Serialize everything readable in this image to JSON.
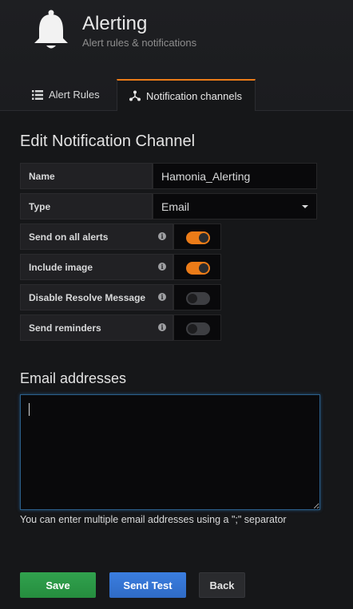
{
  "header": {
    "title": "Alerting",
    "subtitle": "Alert rules & notifications",
    "icon": "bell-icon"
  },
  "tabs": [
    {
      "label": "Alert Rules",
      "icon": "list-icon",
      "active": false
    },
    {
      "label": "Notification channels",
      "icon": "channels-icon",
      "active": true
    }
  ],
  "form": {
    "title": "Edit Notification Channel",
    "name": {
      "label": "Name",
      "value": "Hamonia_Alerting"
    },
    "type": {
      "label": "Type",
      "value": "Email"
    },
    "toggles": [
      {
        "label": "Send on all alerts",
        "checked": true
      },
      {
        "label": "Include image",
        "checked": true
      },
      {
        "label": "Disable Resolve Message",
        "checked": false
      },
      {
        "label": "Send reminders",
        "checked": false
      }
    ],
    "info_glyph": "i"
  },
  "email": {
    "title": "Email addresses",
    "value": "",
    "help": "You can enter multiple email addresses using a \";\" separator"
  },
  "buttons": {
    "save": "Save",
    "test": "Send Test",
    "back": "Back"
  },
  "colors": {
    "accent": "#eb7b18",
    "save": "#299c46",
    "test": "#3274d9"
  }
}
